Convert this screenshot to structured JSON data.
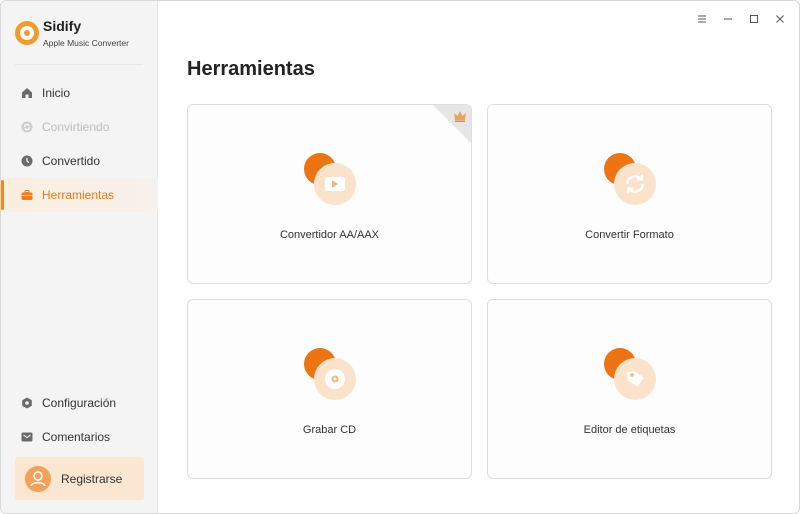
{
  "app": {
    "name": "Sidify",
    "subtitle": "Apple Music Converter"
  },
  "sidebar": {
    "items": [
      {
        "label": "Inicio",
        "icon": "home-icon",
        "state": "normal"
      },
      {
        "label": "Convirtiendo",
        "icon": "sync-icon",
        "state": "disabled"
      },
      {
        "label": "Convertido",
        "icon": "clock-icon",
        "state": "normal"
      },
      {
        "label": "Herramientas",
        "icon": "toolbox-icon",
        "state": "active"
      }
    ],
    "bottom_items": [
      {
        "label": "Configuración",
        "icon": "gear-icon"
      },
      {
        "label": "Comentarios",
        "icon": "mail-icon"
      }
    ],
    "register_label": "Registrarse"
  },
  "window_controls": [
    "menu-icon",
    "minimize-icon",
    "maximize-icon",
    "close-icon"
  ],
  "main": {
    "title": "Herramientas",
    "tools": [
      {
        "label": "Convertidor AA/AAX",
        "icon": "video-icon",
        "premium": true
      },
      {
        "label": "Convertir Formato",
        "icon": "refresh-icon",
        "premium": false
      },
      {
        "label": "Grabar CD",
        "icon": "disc-icon",
        "premium": false
      },
      {
        "label": "Editor de etiquetas",
        "icon": "tag-icon",
        "premium": false
      }
    ]
  },
  "colors": {
    "accent": "#ec7a17",
    "accent_dark": "#e86b0b",
    "accent_light": "#fbe6d1",
    "sidebar_bg": "#f4f4f4"
  }
}
